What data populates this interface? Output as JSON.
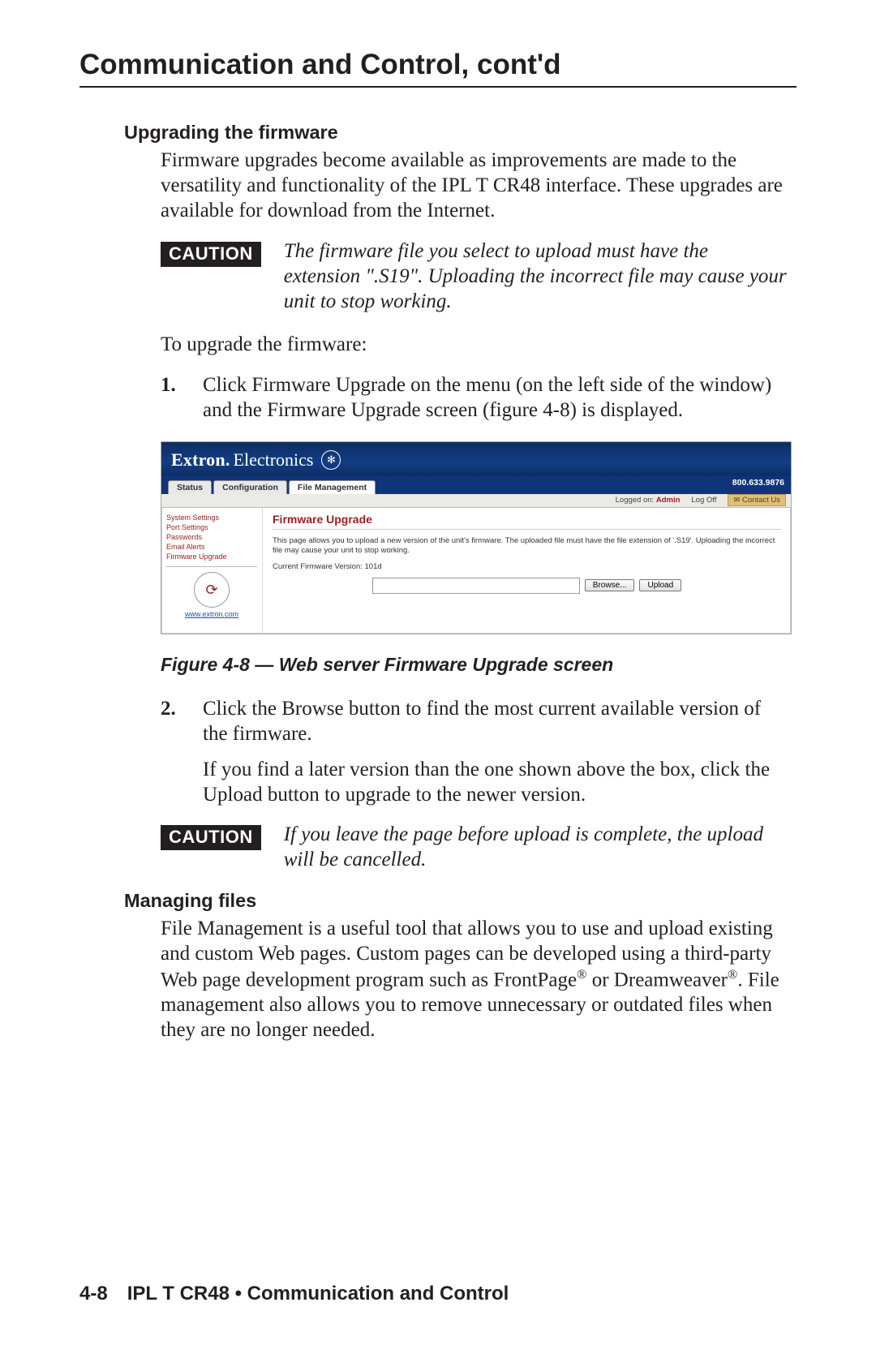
{
  "chapter_title": "Communication and Control, cont'd",
  "section1_title": "Upgrading the firmware",
  "section1_body": "Firmware upgrades become available as improvements are made to the versatility and functionality of the IPL T CR48 interface.  These upgrades are available for download from the Internet.",
  "caution_label": "CAUTION",
  "caution1_text": "The firmware file you select to upload must have the extension \".S19\".  Uploading the incorrect file may cause your unit to stop working.",
  "to_upgrade": "To upgrade the firmware:",
  "step1_num": "1.",
  "step1_text": "Click Firmware Upgrade on the menu (on the left side of the window) and the Firmware Upgrade screen (figure 4-8) is displayed.",
  "figure_caption": "Figure 4-8 — Web server Firmware Upgrade screen",
  "step2_num": "2.",
  "step2_text": "Click the Browse button to find the most current available version of the firmware.",
  "step2_follow": "If you find a later version than the one shown above the box, click the Upload button to upgrade to the newer version.",
  "caution2_text": "If you leave the page before upload is complete, the upload will be cancelled.",
  "section2_title": "Managing files",
  "section2_body_a": "File Management is a useful tool that allows you to use and upload existing and custom Web pages.  Custom pages can be developed using a third-party Web page development program such as FrontPage",
  "section2_body_b": " or Dreamweaver",
  "section2_body_c": ".  File management also allows you to remove unnecessary or outdated files when they are no longer needed.",
  "footer_page": "4-8",
  "footer_text": "IPL T CR48 • Communication and Control",
  "screenshot": {
    "brand1": "Extron",
    "brand2": "Electronics",
    "tabs": {
      "status": "Status",
      "config": "Configuration",
      "fileman": "File Management"
    },
    "phone": "800.633.9876",
    "logged_label": "Logged on:",
    "logged_user": "Admin",
    "logoff": "Log Off",
    "contact": "Contact Us",
    "sidebar": {
      "system": "System Settings",
      "port": "Port Settings",
      "passwords": "Passwords",
      "email": "Email Alerts",
      "firmware": "Firmware Upgrade",
      "link": "www.extron.com"
    },
    "main": {
      "heading": "Firmware Upgrade",
      "desc": "This page allows you to upload a new version of the unit's firmware. The uploaded file must have the file extension of '.S19'. Uploading the incorrect file may cause your unit to stop working.",
      "version": "Current Firmware Version: 101d",
      "browse": "Browse...",
      "upload": "Upload"
    }
  }
}
